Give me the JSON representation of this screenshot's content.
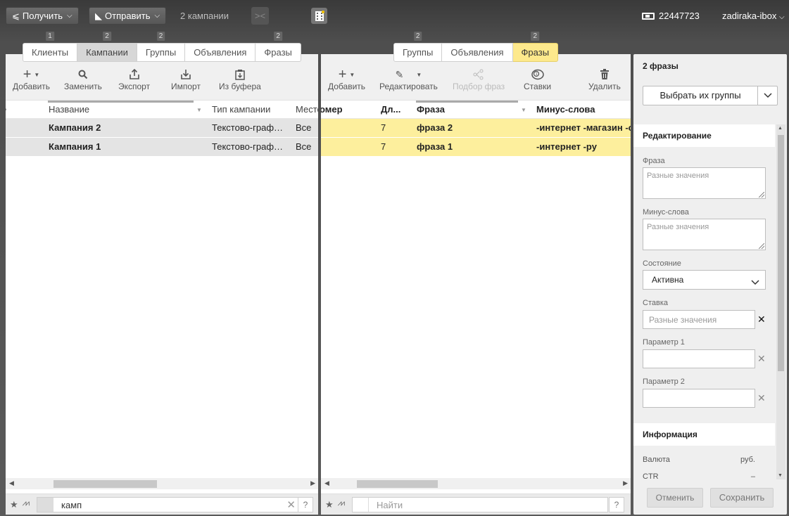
{
  "topbar": {
    "receive_label": "Получить",
    "send_label": "Отправить",
    "campaigns_count": "2 кампании",
    "balance": "22447723",
    "user": "zadiraka-ibox"
  },
  "left_tabs": [
    {
      "label": "Клиенты",
      "badge": "1"
    },
    {
      "label": "Кампании",
      "badge": "2"
    },
    {
      "label": "Группы",
      "badge": "2"
    },
    {
      "label": "Объявления",
      "badge": ""
    },
    {
      "label": "Фразы",
      "badge": "2"
    }
  ],
  "mid_tabs": [
    {
      "label": "Группы",
      "badge": "2"
    },
    {
      "label": "Объявления",
      "badge": ""
    },
    {
      "label": "Фразы",
      "badge": "2"
    }
  ],
  "left_panel": {
    "toolbar": {
      "add": "Добавить",
      "replace": "Заменить",
      "export": "Экспорт",
      "import": "Импорт",
      "from_buffer": "Из буфера"
    },
    "columns": {
      "name": "Название",
      "type": "Тип кампании",
      "place": "Место"
    },
    "rows": [
      {
        "name": "Кампания 2",
        "type": "Текстово-граф…",
        "place": "Все"
      },
      {
        "name": "Кампания 1",
        "type": "Текстово-граф…",
        "place": "Все"
      }
    ],
    "search_value": "камп"
  },
  "mid_panel": {
    "toolbar": {
      "add": "Добавить",
      "edit": "Редактировать",
      "phrase_selection": "Подбор фраз",
      "bids": "Ставки",
      "delete": "Удалить"
    },
    "columns": {
      "number": "омер",
      "length": "Дл...",
      "phrase": "Фраза",
      "minus_words": "Минус-слова"
    },
    "rows": [
      {
        "length": "7",
        "phrase": "фраза 2",
        "minus": "-интернет -магазин -c"
      },
      {
        "length": "7",
        "phrase": "фраза 1",
        "minus": "-интернет -ру"
      }
    ],
    "search_placeholder": "Найти"
  },
  "side_panel": {
    "title": "2 фразы",
    "pick_groups": "Выбрать их группы",
    "editing_title": "Редактирование",
    "phrase_label": "Фраза",
    "phrase_placeholder": "Разные значения",
    "minus_label": "Минус-слова",
    "minus_placeholder": "Разные значения",
    "state_label": "Состояние",
    "state_value": "Активна",
    "bid_label": "Ставка",
    "bid_placeholder": "Разные значения",
    "param1_label": "Параметр 1",
    "param2_label": "Параметр 2",
    "info_title": "Информация",
    "currency_label": "Валюта",
    "currency_value": "руб.",
    "ctr_label": "CTR",
    "ctr_value": "–",
    "cancel": "Отменить",
    "save": "Сохранить"
  },
  "help_label": "?",
  "colors": {
    "accent_yellow": "#fde98c",
    "row_yellow": "#fdef9d",
    "row_grey": "#e4e4e4"
  }
}
